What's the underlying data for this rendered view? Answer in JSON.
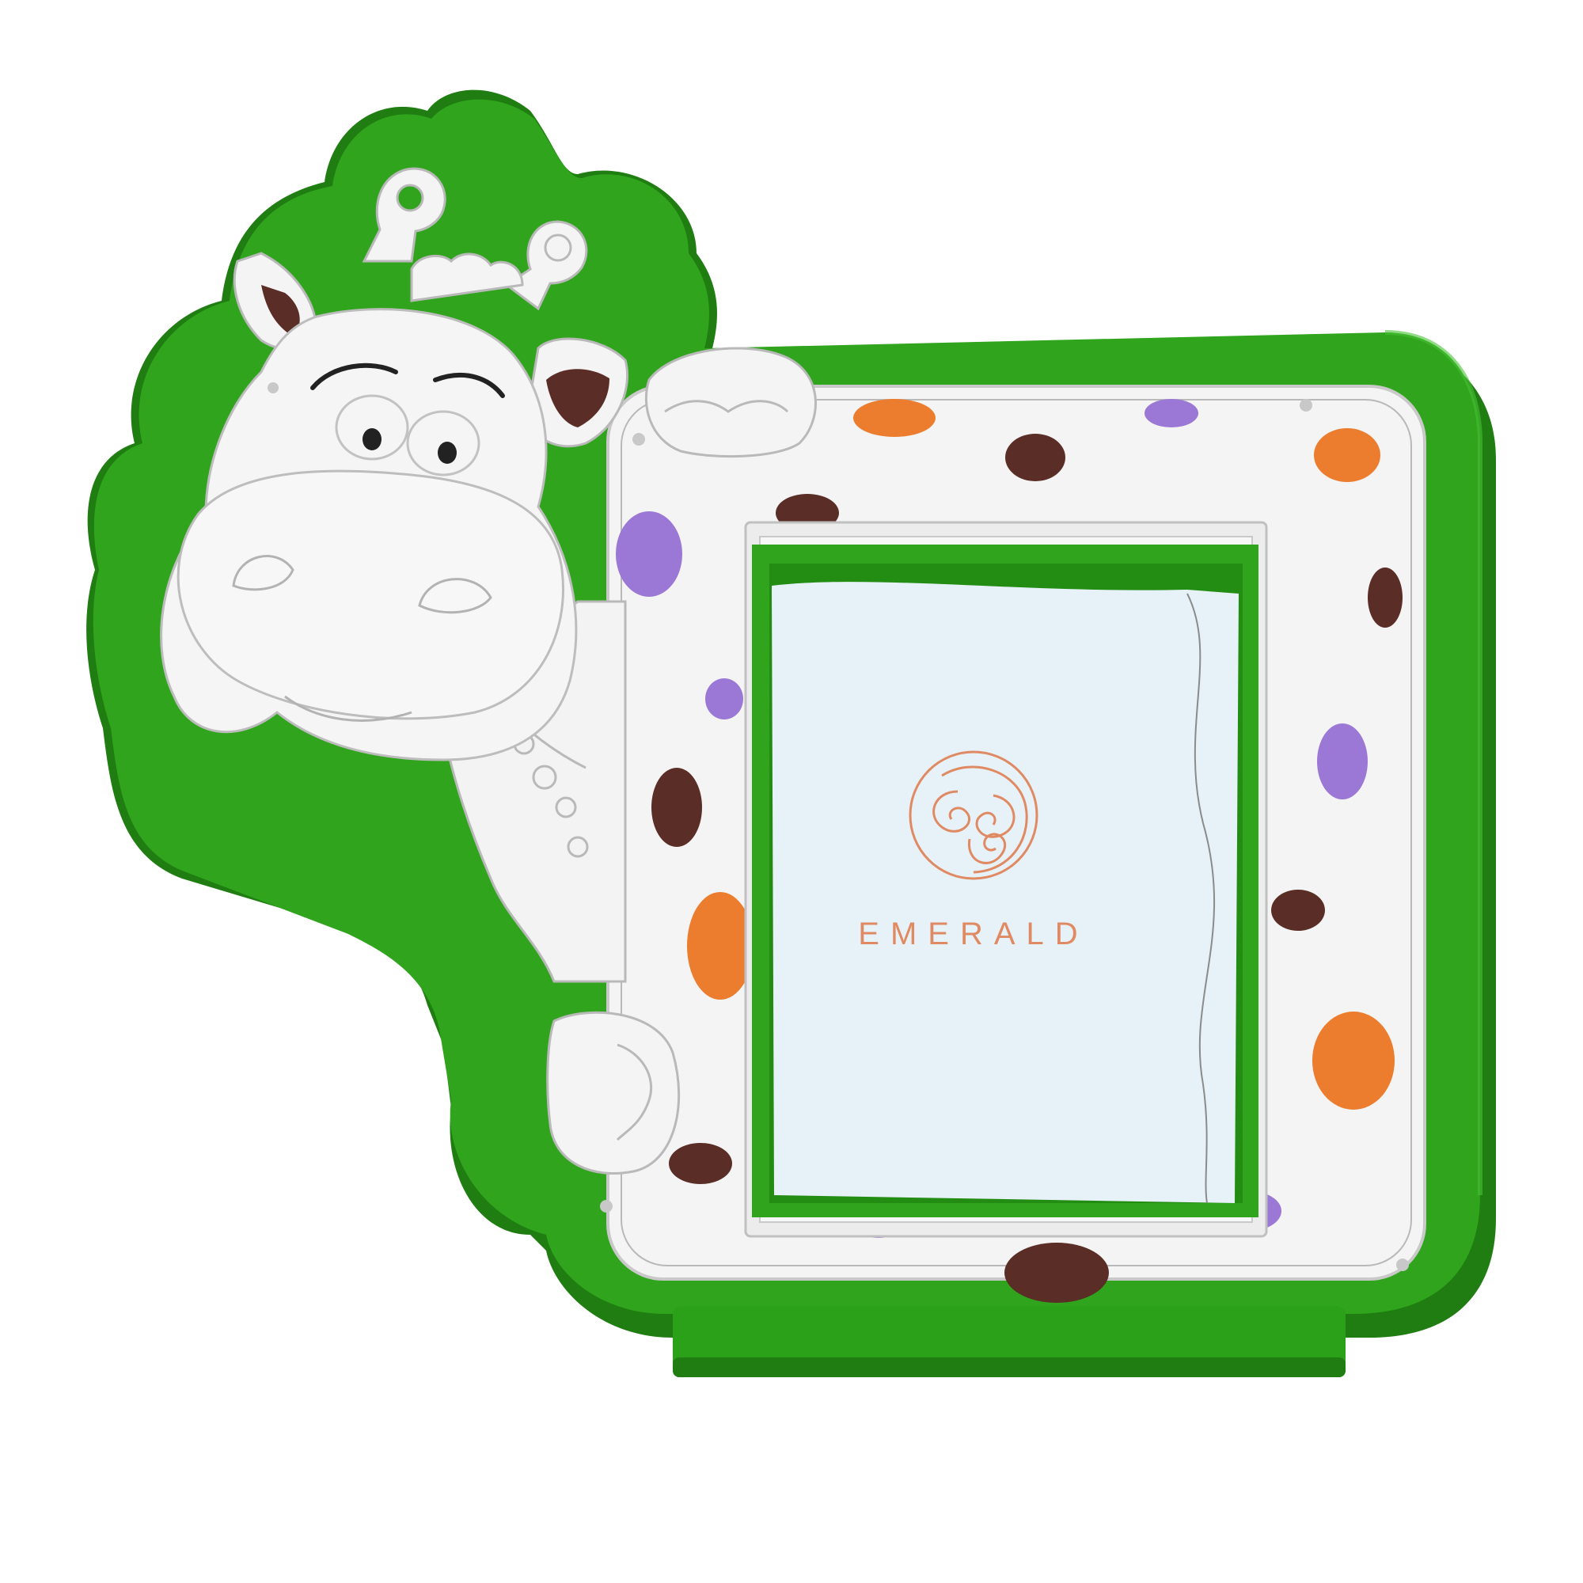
{
  "photo": {
    "subject": "giraffe-photo-frame",
    "insert_card": {
      "brand_text": "EMERALD",
      "logo_icon": "triple-spiral-logo-icon"
    }
  },
  "colors": {
    "background": "#ffffff",
    "frame_green": "#2fa41c",
    "frame_green_dark": "#228414",
    "silver": "#f4f4f4",
    "silver_line": "#b9b9b9",
    "card": "#e6f2f7",
    "spot_orange": "#ec7d2f",
    "spot_purple": "#9b78d6",
    "spot_brown": "#5a2e26",
    "brand_text": "#e08a64"
  }
}
